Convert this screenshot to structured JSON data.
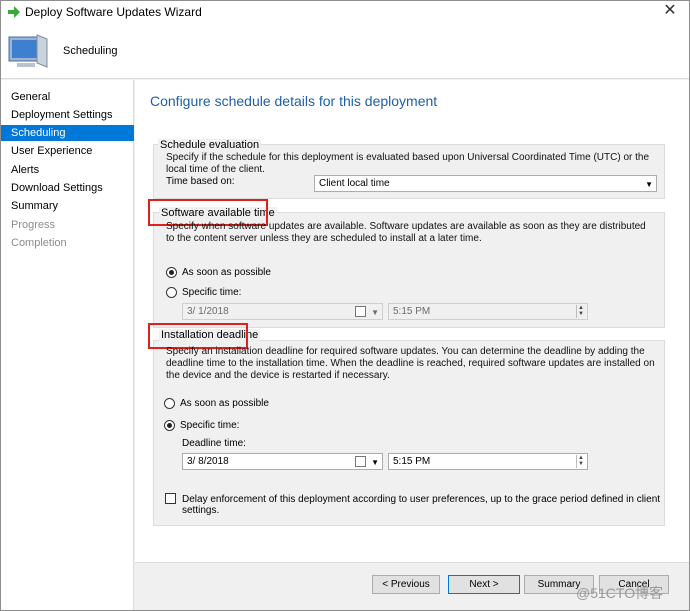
{
  "window": {
    "title": "Deploy Software Updates Wizard",
    "close_glyph": "✕"
  },
  "header": {
    "title": "Scheduling"
  },
  "sidebar": {
    "items": [
      {
        "label": "General",
        "state": "normal"
      },
      {
        "label": "Deployment Settings",
        "state": "normal"
      },
      {
        "label": "Scheduling",
        "state": "active"
      },
      {
        "label": "User Experience",
        "state": "normal"
      },
      {
        "label": "Alerts",
        "state": "normal"
      },
      {
        "label": "Download Settings",
        "state": "normal"
      },
      {
        "label": "Summary",
        "state": "normal"
      },
      {
        "label": "Progress",
        "state": "disabled"
      },
      {
        "label": "Completion",
        "state": "disabled"
      }
    ]
  },
  "main": {
    "title": "Configure schedule details for this deployment",
    "schedule_evaluation": {
      "label": "Schedule evaluation",
      "description": "Specify if the schedule for this deployment is evaluated based upon Universal Coordinated Time (UTC) or the local time of the client.",
      "time_based_label": "Time based on:",
      "time_based_value": "Client local time"
    },
    "available_time": {
      "label": "Software available time",
      "description": "Specify when software updates are available. Software updates are available as soon as they are distributed to the content server unless they are scheduled to install at a later time.",
      "asap_label": "As soon as possible",
      "specific_label": "Specific time:",
      "date_value": "3/  1/2018",
      "time_value": "5:15 PM"
    },
    "deadline": {
      "label": "Installation deadline",
      "description": "Specify an installation deadline for required software updates. You can determine the deadline by adding the deadline time to the installation time. When the deadline is reached, required software updates are installed on the device and the device is restarted if necessary.",
      "asap_label": "As soon as possible",
      "specific_label": "Specific time:",
      "deadline_time_label": "Deadline time:",
      "date_value": "3/  8/2018",
      "time_value": "5:15 PM",
      "delay_label": "Delay enforcement of this deployment according to user preferences, up to the grace period defined in client settings."
    }
  },
  "buttons": {
    "previous": "< Previous",
    "next": "Next >",
    "summary": "Summary",
    "cancel": "Cancel"
  },
  "watermark": "@51CTO博客",
  "colors": {
    "accent": "#0078d7",
    "title_blue": "#1f5fa8",
    "highlight_red": "#e0201c"
  }
}
